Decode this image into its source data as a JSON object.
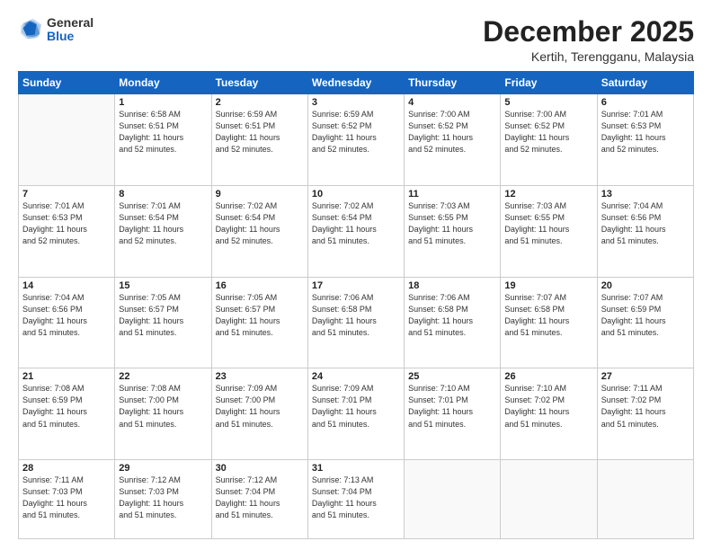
{
  "header": {
    "logo_general": "General",
    "logo_blue": "Blue",
    "month_title": "December 2025",
    "location": "Kertih, Terengganu, Malaysia"
  },
  "days_of_week": [
    "Sunday",
    "Monday",
    "Tuesday",
    "Wednesday",
    "Thursday",
    "Friday",
    "Saturday"
  ],
  "weeks": [
    [
      {
        "day": "",
        "sunrise": "",
        "sunset": "",
        "daylight": ""
      },
      {
        "day": "1",
        "sunrise": "Sunrise: 6:58 AM",
        "sunset": "Sunset: 6:51 PM",
        "daylight": "Daylight: 11 hours and 52 minutes."
      },
      {
        "day": "2",
        "sunrise": "Sunrise: 6:59 AM",
        "sunset": "Sunset: 6:51 PM",
        "daylight": "Daylight: 11 hours and 52 minutes."
      },
      {
        "day": "3",
        "sunrise": "Sunrise: 6:59 AM",
        "sunset": "Sunset: 6:52 PM",
        "daylight": "Daylight: 11 hours and 52 minutes."
      },
      {
        "day": "4",
        "sunrise": "Sunrise: 7:00 AM",
        "sunset": "Sunset: 6:52 PM",
        "daylight": "Daylight: 11 hours and 52 minutes."
      },
      {
        "day": "5",
        "sunrise": "Sunrise: 7:00 AM",
        "sunset": "Sunset: 6:52 PM",
        "daylight": "Daylight: 11 hours and 52 minutes."
      },
      {
        "day": "6",
        "sunrise": "Sunrise: 7:01 AM",
        "sunset": "Sunset: 6:53 PM",
        "daylight": "Daylight: 11 hours and 52 minutes."
      }
    ],
    [
      {
        "day": "7",
        "sunrise": "Sunrise: 7:01 AM",
        "sunset": "Sunset: 6:53 PM",
        "daylight": "Daylight: 11 hours and 52 minutes."
      },
      {
        "day": "8",
        "sunrise": "Sunrise: 7:01 AM",
        "sunset": "Sunset: 6:54 PM",
        "daylight": "Daylight: 11 hours and 52 minutes."
      },
      {
        "day": "9",
        "sunrise": "Sunrise: 7:02 AM",
        "sunset": "Sunset: 6:54 PM",
        "daylight": "Daylight: 11 hours and 52 minutes."
      },
      {
        "day": "10",
        "sunrise": "Sunrise: 7:02 AM",
        "sunset": "Sunset: 6:54 PM",
        "daylight": "Daylight: 11 hours and 51 minutes."
      },
      {
        "day": "11",
        "sunrise": "Sunrise: 7:03 AM",
        "sunset": "Sunset: 6:55 PM",
        "daylight": "Daylight: 11 hours and 51 minutes."
      },
      {
        "day": "12",
        "sunrise": "Sunrise: 7:03 AM",
        "sunset": "Sunset: 6:55 PM",
        "daylight": "Daylight: 11 hours and 51 minutes."
      },
      {
        "day": "13",
        "sunrise": "Sunrise: 7:04 AM",
        "sunset": "Sunset: 6:56 PM",
        "daylight": "Daylight: 11 hours and 51 minutes."
      }
    ],
    [
      {
        "day": "14",
        "sunrise": "Sunrise: 7:04 AM",
        "sunset": "Sunset: 6:56 PM",
        "daylight": "Daylight: 11 hours and 51 minutes."
      },
      {
        "day": "15",
        "sunrise": "Sunrise: 7:05 AM",
        "sunset": "Sunset: 6:57 PM",
        "daylight": "Daylight: 11 hours and 51 minutes."
      },
      {
        "day": "16",
        "sunrise": "Sunrise: 7:05 AM",
        "sunset": "Sunset: 6:57 PM",
        "daylight": "Daylight: 11 hours and 51 minutes."
      },
      {
        "day": "17",
        "sunrise": "Sunrise: 7:06 AM",
        "sunset": "Sunset: 6:58 PM",
        "daylight": "Daylight: 11 hours and 51 minutes."
      },
      {
        "day": "18",
        "sunrise": "Sunrise: 7:06 AM",
        "sunset": "Sunset: 6:58 PM",
        "daylight": "Daylight: 11 hours and 51 minutes."
      },
      {
        "day": "19",
        "sunrise": "Sunrise: 7:07 AM",
        "sunset": "Sunset: 6:58 PM",
        "daylight": "Daylight: 11 hours and 51 minutes."
      },
      {
        "day": "20",
        "sunrise": "Sunrise: 7:07 AM",
        "sunset": "Sunset: 6:59 PM",
        "daylight": "Daylight: 11 hours and 51 minutes."
      }
    ],
    [
      {
        "day": "21",
        "sunrise": "Sunrise: 7:08 AM",
        "sunset": "Sunset: 6:59 PM",
        "daylight": "Daylight: 11 hours and 51 minutes."
      },
      {
        "day": "22",
        "sunrise": "Sunrise: 7:08 AM",
        "sunset": "Sunset: 7:00 PM",
        "daylight": "Daylight: 11 hours and 51 minutes."
      },
      {
        "day": "23",
        "sunrise": "Sunrise: 7:09 AM",
        "sunset": "Sunset: 7:00 PM",
        "daylight": "Daylight: 11 hours and 51 minutes."
      },
      {
        "day": "24",
        "sunrise": "Sunrise: 7:09 AM",
        "sunset": "Sunset: 7:01 PM",
        "daylight": "Daylight: 11 hours and 51 minutes."
      },
      {
        "day": "25",
        "sunrise": "Sunrise: 7:10 AM",
        "sunset": "Sunset: 7:01 PM",
        "daylight": "Daylight: 11 hours and 51 minutes."
      },
      {
        "day": "26",
        "sunrise": "Sunrise: 7:10 AM",
        "sunset": "Sunset: 7:02 PM",
        "daylight": "Daylight: 11 hours and 51 minutes."
      },
      {
        "day": "27",
        "sunrise": "Sunrise: 7:11 AM",
        "sunset": "Sunset: 7:02 PM",
        "daylight": "Daylight: 11 hours and 51 minutes."
      }
    ],
    [
      {
        "day": "28",
        "sunrise": "Sunrise: 7:11 AM",
        "sunset": "Sunset: 7:03 PM",
        "daylight": "Daylight: 11 hours and 51 minutes."
      },
      {
        "day": "29",
        "sunrise": "Sunrise: 7:12 AM",
        "sunset": "Sunset: 7:03 PM",
        "daylight": "Daylight: 11 hours and 51 minutes."
      },
      {
        "day": "30",
        "sunrise": "Sunrise: 7:12 AM",
        "sunset": "Sunset: 7:04 PM",
        "daylight": "Daylight: 11 hours and 51 minutes."
      },
      {
        "day": "31",
        "sunrise": "Sunrise: 7:13 AM",
        "sunset": "Sunset: 7:04 PM",
        "daylight": "Daylight: 11 hours and 51 minutes."
      },
      {
        "day": "",
        "sunrise": "",
        "sunset": "",
        "daylight": ""
      },
      {
        "day": "",
        "sunrise": "",
        "sunset": "",
        "daylight": ""
      },
      {
        "day": "",
        "sunrise": "",
        "sunset": "",
        "daylight": ""
      }
    ]
  ]
}
